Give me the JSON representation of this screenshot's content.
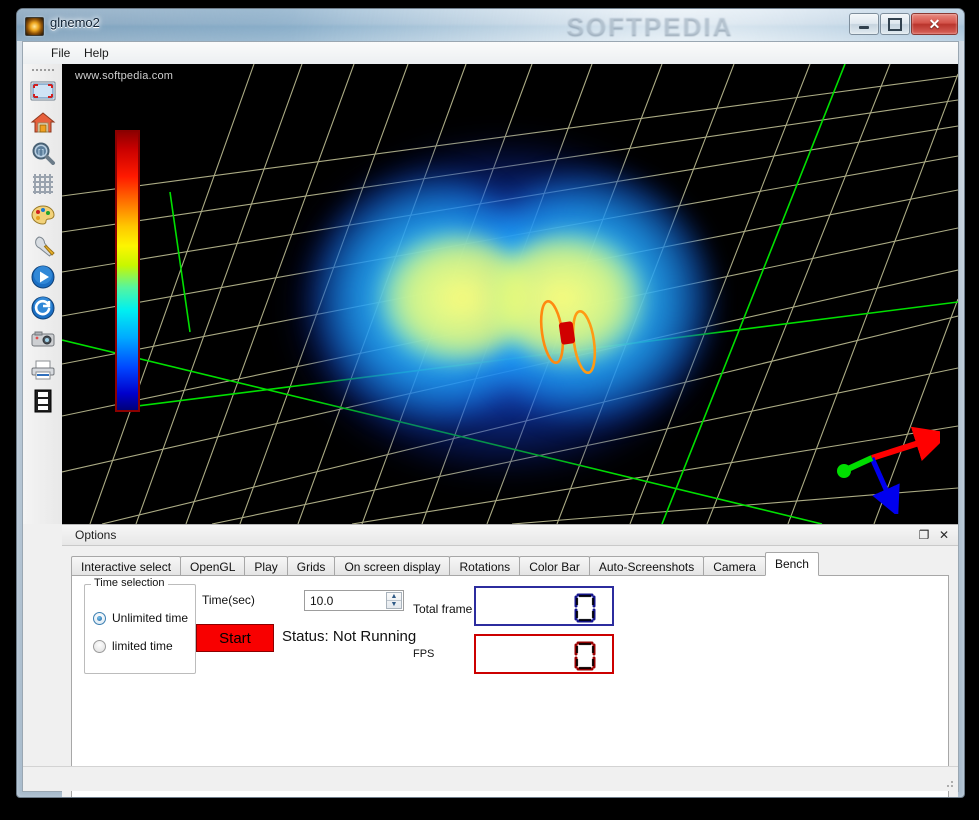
{
  "window": {
    "title": "glnemo2",
    "icon": "app-sphere-icon",
    "watermark_large": "SOFTPEDIA",
    "controls": {
      "minimize": "–",
      "maximize": "□",
      "close": "✕"
    }
  },
  "menubar": {
    "items": [
      {
        "label": "File"
      },
      {
        "label": "Help"
      }
    ]
  },
  "toolbar": {
    "items": [
      {
        "name": "fullscreen-icon",
        "tip": "Fullscreen"
      },
      {
        "name": "home-icon",
        "tip": "Reset view"
      },
      {
        "name": "zoom-icon",
        "tip": "Zoom"
      },
      {
        "name": "grid-icon",
        "tip": "Grids"
      },
      {
        "name": "palette-icon",
        "tip": "Color bar"
      },
      {
        "name": "wrench-icon",
        "tip": "Options"
      },
      {
        "name": "play-icon",
        "tip": "Play"
      },
      {
        "name": "rotate-icon",
        "tip": "Rotations"
      },
      {
        "name": "camera-icon",
        "tip": "Screenshot"
      },
      {
        "name": "printer-icon",
        "tip": "Print"
      },
      {
        "name": "film-icon",
        "tip": "Movie"
      }
    ]
  },
  "viewport": {
    "watermark_small": "www.softpedia.com",
    "background": "#000000",
    "grid_color": "#b5b58c",
    "axis_color": "#00e000",
    "colorbar": {
      "name": "color-bar",
      "border": "#8b0000",
      "stops": [
        "#8f0000",
        "#c80000",
        "#ff1a00",
        "#ff7a00",
        "#ffc800",
        "#fdf500",
        "#c8f700",
        "#55f5a0",
        "#00f0f0",
        "#00aaff",
        "#0044ff",
        "#0000cc",
        "#00007a"
      ]
    },
    "triad": {
      "x_axis_color": "#ff0000",
      "y_axis_color": "#00dd00",
      "z_axis_color": "#0000ee"
    }
  },
  "options_dock": {
    "title": "Options",
    "float_glyph": "❐",
    "close_glyph": "✕",
    "tabs": [
      {
        "label": "Interactive select",
        "active": false
      },
      {
        "label": "OpenGL",
        "active": false
      },
      {
        "label": "Play",
        "active": false
      },
      {
        "label": "Grids",
        "active": false
      },
      {
        "label": "On screen display",
        "active": false
      },
      {
        "label": "Rotations",
        "active": false
      },
      {
        "label": "Color Bar",
        "active": false
      },
      {
        "label": "Auto-Screenshots",
        "active": false
      },
      {
        "label": "Camera",
        "active": false
      },
      {
        "label": "Bench",
        "active": true
      }
    ],
    "bench": {
      "time_selection": {
        "legend": "Time selection",
        "options": [
          {
            "label": "Unlimited time",
            "selected": true
          },
          {
            "label": "limited time",
            "selected": false
          }
        ]
      },
      "time_label": "Time(sec)",
      "time_value": "10.0",
      "spin_up": "▲",
      "spin_down": "▼",
      "start_button": "Start",
      "status_text": "Status: Not Running",
      "total_frame_label": "Total frame",
      "total_frame_value": "0",
      "total_frame_color": "#2c2c9e",
      "fps_label": "FPS",
      "fps_value": "0",
      "fps_color": "#cc0000"
    }
  },
  "statusbar": {
    "text": ""
  }
}
